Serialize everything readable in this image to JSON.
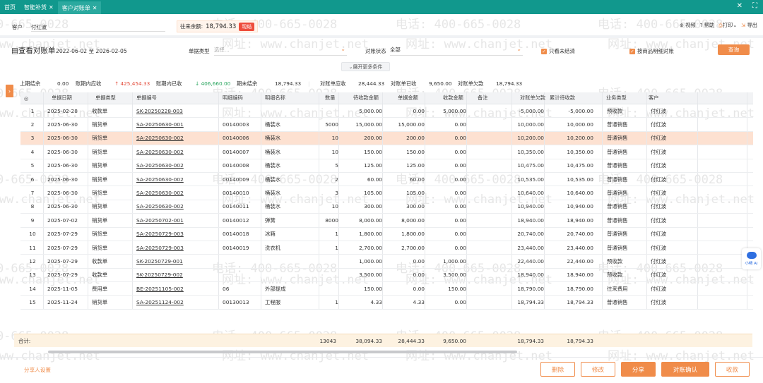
{
  "tabs": [
    {
      "label": "首页",
      "closable": false
    },
    {
      "label": "智能补货",
      "closable": true
    },
    {
      "label": "客户对账单",
      "closable": true
    }
  ],
  "window_controls": {
    "close": "✕",
    "maximize": "⛶"
  },
  "filter": {
    "customer_label": "客户",
    "customer_value": "付红波"
  },
  "balance": {
    "label": "往来余额:",
    "value": "18,794.33",
    "badge": "现结"
  },
  "tools": {
    "video": "视频",
    "help": "帮助",
    "print": "打印",
    "export": "导出"
  },
  "page": {
    "title": "查看对账单",
    "date_range": "2022-06-02 至 2026-02-05"
  },
  "search": {
    "doc_type_label": "单据类型",
    "doc_type_placeholder": "选择...",
    "status_label": "对账状态",
    "status_value": "全部",
    "only_unsettled_label": "只看未结清",
    "only_unsettled_checked": true,
    "by_detail_label": "按商品明细对账",
    "by_detail_checked": true,
    "query_button": "查询",
    "expand_label": "展开更多条件"
  },
  "summary": {
    "opening_label": "上期结余",
    "opening_value": "0.00",
    "receivable_label": "账期内应收",
    "receivable_value": "425,454.33",
    "received_label": "账期内已收",
    "received_value": "406,660.00",
    "closing_label": "期末结余",
    "closing_value": "18,794.33",
    "stmt_receivable_label": "对账单应收",
    "stmt_receivable_value": "28,444.33",
    "stmt_received_label": "对账单已收",
    "stmt_received_value": "9,650.00",
    "stmt_owed_label": "对账单欠款",
    "stmt_owed_value": "18,794.33"
  },
  "table": {
    "columns": [
      "",
      "单据日期",
      "单据类型",
      "单据编号",
      "明细编码",
      "明细名称",
      "数量",
      "待收款金额",
      "单据金额",
      "收款金额",
      "备注",
      "对账单欠款",
      "累计待收款",
      "业务类型",
      "客户",
      ""
    ],
    "rows": [
      [
        "1",
        "2025-02-28",
        "收款单",
        "SK-20250228-003",
        "",
        "",
        "",
        "5,000.00",
        "0.00",
        "5,000.00",
        "",
        "-5,000.00",
        "-5,000.00",
        "预收款",
        "付红波"
      ],
      [
        "2",
        "2025-06-30",
        "销货单",
        "SA-20250630-001",
        "00140003",
        "桶装水",
        "5000",
        "15,000.00",
        "15,000.00",
        "0.00",
        "",
        "10,000.00",
        "10,000.00",
        "普通销售",
        "付红波"
      ],
      [
        "3",
        "2025-06-30",
        "销货单",
        "SA-20250630-002",
        "00140006",
        "桶装水",
        "10",
        "200.00",
        "200.00",
        "0.00",
        "",
        "10,200.00",
        "10,200.00",
        "普通销售",
        "付红波"
      ],
      [
        "4",
        "2025-06-30",
        "销货单",
        "SA-20250630-002",
        "00140007",
        "桶装水",
        "10",
        "150.00",
        "150.00",
        "0.00",
        "",
        "10,350.00",
        "10,350.00",
        "普通销售",
        "付红波"
      ],
      [
        "5",
        "2025-06-30",
        "销货单",
        "SA-20250630-002",
        "00140008",
        "桶装水",
        "5",
        "125.00",
        "125.00",
        "0.00",
        "",
        "10,475.00",
        "10,475.00",
        "普通销售",
        "付红波"
      ],
      [
        "6",
        "2025-06-30",
        "销货单",
        "SA-20250630-002",
        "00140009",
        "桶装水",
        "2",
        "60.00",
        "60.00",
        "0.00",
        "",
        "10,535.00",
        "10,535.00",
        "普通销售",
        "付红波"
      ],
      [
        "7",
        "2025-06-30",
        "销货单",
        "SA-20250630-002",
        "00140010",
        "桶装水",
        "3",
        "105.00",
        "105.00",
        "0.00",
        "",
        "10,640.00",
        "10,640.00",
        "普通销售",
        "付红波"
      ],
      [
        "8",
        "2025-06-30",
        "销货单",
        "SA-20250630-002",
        "00140011",
        "桶装水",
        "10",
        "300.00",
        "300.00",
        "0.00",
        "",
        "10,940.00",
        "10,940.00",
        "普通销售",
        "付红波"
      ],
      [
        "9",
        "2025-07-02",
        "销货单",
        "SA-20250702-001",
        "00140012",
        "弹簧",
        "8000",
        "8,000.00",
        "8,000.00",
        "0.00",
        "",
        "18,940.00",
        "18,940.00",
        "普通销售",
        "付红波"
      ],
      [
        "10",
        "2025-07-29",
        "销货单",
        "SA-20250729-003",
        "00140018",
        "冰箱",
        "1",
        "1,800.00",
        "1,800.00",
        "0.00",
        "",
        "20,740.00",
        "20,740.00",
        "普通销售",
        "付红波"
      ],
      [
        "11",
        "2025-07-29",
        "销货单",
        "SA-20250729-003",
        "00140019",
        "洗衣机",
        "1",
        "2,700.00",
        "2,700.00",
        "0.00",
        "",
        "23,440.00",
        "23,440.00",
        "普通销售",
        "付红波"
      ],
      [
        "12",
        "2025-07-29",
        "收款单",
        "SK-20250729-001",
        "",
        "",
        "",
        "1,000.00",
        "0.00",
        "1,000.00",
        "",
        "22,440.00",
        "22,440.00",
        "预收款",
        "付红波"
      ],
      [
        "13",
        "2025-07-29",
        "收款单",
        "SK-20250729-002",
        "",
        "",
        "",
        "3,500.00",
        "0.00",
        "3,500.00",
        "",
        "18,940.00",
        "18,940.00",
        "预收款",
        "付红波"
      ],
      [
        "14",
        "2025-11-05",
        "费用单",
        "BE-20251105-002",
        "06",
        "外部提成",
        "",
        "150.00",
        "0.00",
        "150.00",
        "",
        "18,790.00",
        "18,790.00",
        "往来费用",
        "付红波"
      ],
      [
        "15",
        "2025-11-24",
        "销货单",
        "SA-20251124-002",
        "00130013",
        "工程服",
        "1",
        "4.33",
        "4.33",
        "0.00",
        "",
        "18,794.33",
        "18,794.33",
        "普通销售",
        "付红波"
      ]
    ],
    "highlighted_row": 3,
    "total": {
      "label": "合计:",
      "qty": "13043",
      "pending": "38,094.33",
      "amount": "28,444.33",
      "received": "9,650.00",
      "owed": "18,794.33",
      "cumulative": "18,794.33"
    }
  },
  "footer": {
    "share_settings": "分享人设置",
    "buttons": [
      "删除",
      "修改",
      "分享",
      "对账确认",
      "收款"
    ]
  },
  "ai_widget": {
    "label": "小畅 AI"
  },
  "watermark": {
    "phone": "电话: 400-665-0028",
    "site": "网址: www.chanjet.net"
  },
  "colors": {
    "header": "#11988d",
    "accent": "#f08c4a",
    "highlight_row": "#fde1d1",
    "up": "#e34d3c",
    "down": "#2aa55f"
  }
}
